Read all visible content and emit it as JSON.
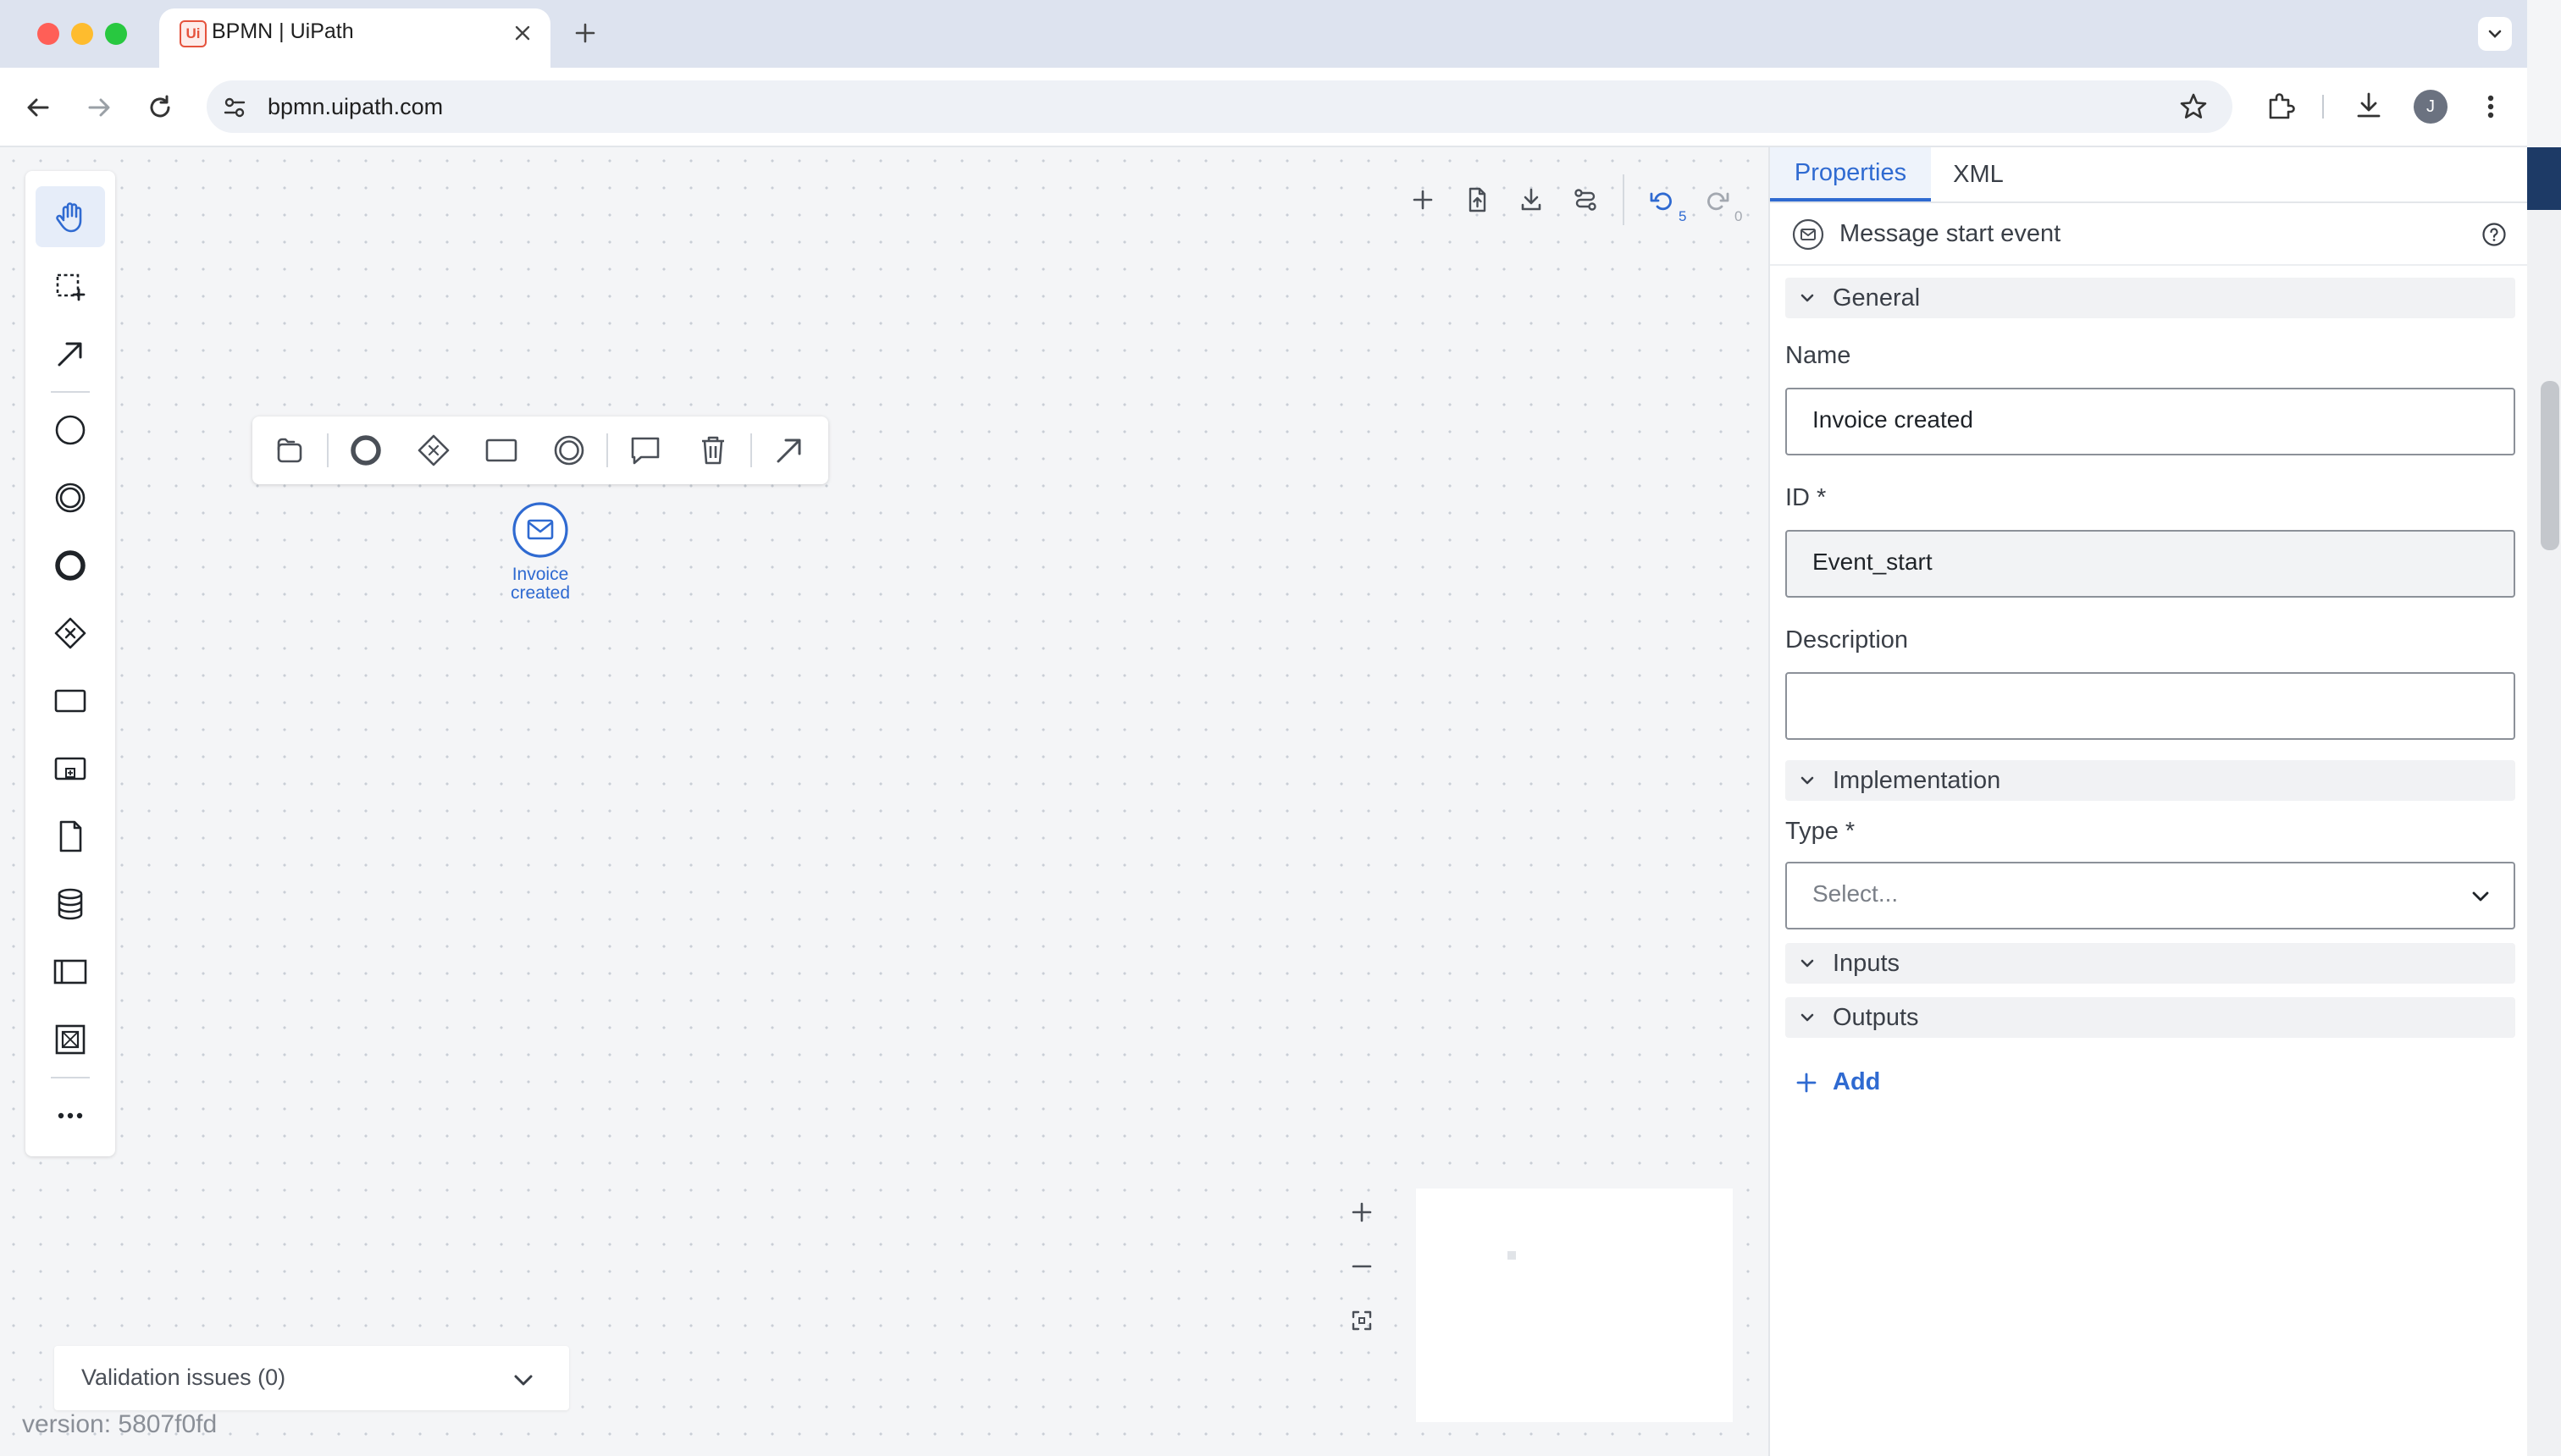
{
  "browser": {
    "tab_title": "BPMN | UiPath",
    "favicon_text": "Ui",
    "url": "bpmn.uipath.com",
    "profile_initial": "J"
  },
  "canvas": {
    "event_label": "Invoice\ncreated",
    "undo_count": "5",
    "redo_count": "0",
    "validation_label": "Validation issues (0)",
    "version": "version: 5807f0fd"
  },
  "palette": {
    "items": [
      "hand-tool",
      "lasso-tool",
      "connect-tool",
      "start-event",
      "intermediate-event",
      "end-event",
      "gateway",
      "task",
      "subprocess",
      "data-object",
      "data-store",
      "pool",
      "group",
      "more"
    ]
  },
  "panel": {
    "tabs": [
      "Properties",
      "XML"
    ],
    "element_type": "Message start event",
    "sections": {
      "general": "General",
      "implementation": "Implementation",
      "inputs": "Inputs",
      "outputs": "Outputs"
    },
    "fields": {
      "name_label": "Name",
      "name_value": "Invoice created",
      "id_label": "ID *",
      "id_value": "Event_start",
      "description_label": "Description",
      "description_value": "",
      "type_label": "Type *",
      "type_placeholder": "Select..."
    },
    "add_label": "Add"
  },
  "colors": {
    "accent": "#2f6ad1",
    "favicon": "#e5533d",
    "canvas_bg": "#f4f5f7"
  }
}
